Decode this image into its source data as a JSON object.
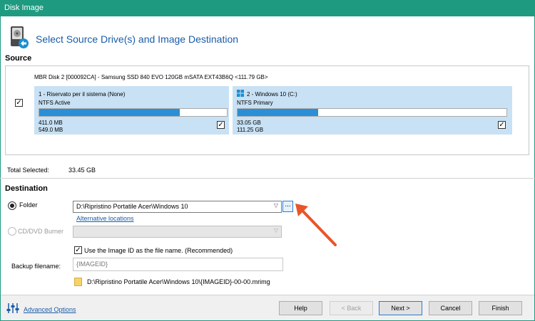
{
  "window": {
    "title": "Disk Image"
  },
  "header": {
    "title": "Select Source Drive(s) and Image Destination"
  },
  "source": {
    "label": "Source",
    "disk_description": "MBR Disk 2 [000092CA] - Samsung SSD 840 EVO 120GB mSATA EXT43B6Q  <111.79 GB>",
    "disk_checked": true,
    "partitions": [
      {
        "name": "1 - Riservato per il sistema (None)",
        "fs": "NTFS Active",
        "used": "411.0 MB",
        "total": "549.0 MB",
        "fill_fraction": 0.75,
        "checked": true
      },
      {
        "name": "2 - Windows 10 (C:)",
        "fs": "NTFS Primary",
        "used": "33.05 GB",
        "total": "111.25 GB",
        "fill_fraction": 0.3,
        "checked": true
      }
    ],
    "total_selected_label": "Total Selected:",
    "total_selected_value": "33.45 GB"
  },
  "destination": {
    "label": "Destination",
    "folder_label": "Folder",
    "folder_selected": true,
    "folder_value": "D:\\Ripristino Portatile Acer\\Windows 10",
    "browse_label": "...",
    "alt_locations_link": "Alternative locations",
    "cd_dvd_label": "CD/DVD Burner",
    "use_image_id_label": "Use the Image ID as the file name.  (Recommended)",
    "use_image_id_checked": true,
    "backup_filename_label": "Backup filename:",
    "backup_filename_placeholder": "{IMAGEID}",
    "path_preview": "D:\\Ripristino Portatile Acer\\Windows 10\\{IMAGEID}-00-00.mrimg"
  },
  "footer": {
    "advanced_options": "Advanced Options",
    "help": "Help",
    "back": "< Back",
    "next": "Next >",
    "cancel": "Cancel",
    "finish": "Finish"
  },
  "colors": {
    "titlebar": "#1e9a80",
    "accent": "#1a5ca8",
    "partition_bg": "#c8e1f4",
    "bar_fill": "#2a8fd6",
    "arrow": "#e8552a"
  }
}
